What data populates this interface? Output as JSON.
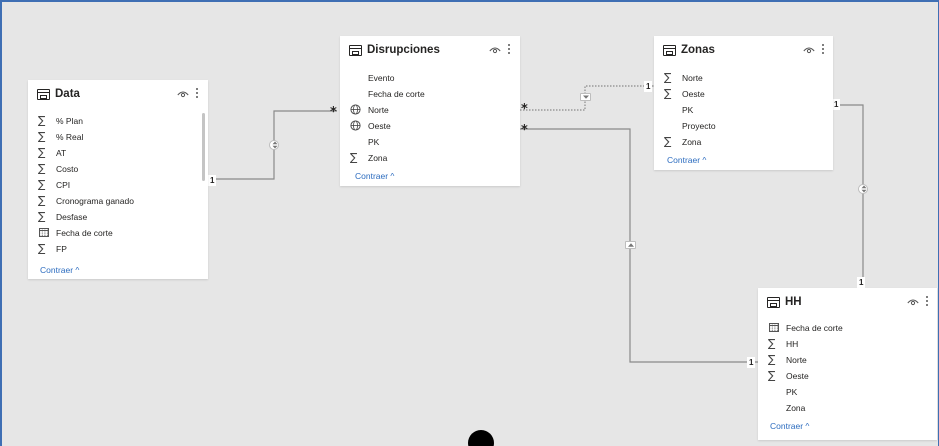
{
  "tables": {
    "data": {
      "title": "Data",
      "fields": [
        {
          "icon": "sigma-icon",
          "label": "% Plan"
        },
        {
          "icon": "sigma-icon",
          "label": "% Real"
        },
        {
          "icon": "sigma-icon",
          "label": "AT"
        },
        {
          "icon": "sigma-icon",
          "label": "Costo"
        },
        {
          "icon": "sigma-icon",
          "label": "CPI"
        },
        {
          "icon": "sigma-icon",
          "label": "Cronograma ganado"
        },
        {
          "icon": "sigma-icon",
          "label": "Desfase"
        },
        {
          "icon": "calendar-icon",
          "label": "Fecha de corte"
        },
        {
          "icon": "sigma-icon",
          "label": "FP"
        }
      ],
      "collapse": "Contraer ^"
    },
    "disrupciones": {
      "title": "Disrupciones",
      "fields": [
        {
          "icon": "none",
          "label": "Evento"
        },
        {
          "icon": "none",
          "label": "Fecha de corte"
        },
        {
          "icon": "globe-icon",
          "label": "Norte"
        },
        {
          "icon": "globe-icon",
          "label": "Oeste"
        },
        {
          "icon": "none",
          "label": "PK"
        },
        {
          "icon": "sigma-icon",
          "label": "Zona"
        }
      ],
      "collapse": "Contraer ^"
    },
    "zonas": {
      "title": "Zonas",
      "fields": [
        {
          "icon": "sigma-icon",
          "label": "Norte"
        },
        {
          "icon": "sigma-icon",
          "label": "Oeste"
        },
        {
          "icon": "none",
          "label": "PK"
        },
        {
          "icon": "none",
          "label": "Proyecto"
        },
        {
          "icon": "sigma-icon",
          "label": "Zona"
        }
      ],
      "collapse": "Contraer ^"
    },
    "hh": {
      "title": "HH",
      "fields": [
        {
          "icon": "calendar-icon",
          "label": "Fecha de corte"
        },
        {
          "icon": "sigma-icon",
          "label": "HH"
        },
        {
          "icon": "sigma-icon",
          "label": "Norte"
        },
        {
          "icon": "sigma-icon",
          "label": "Oeste"
        },
        {
          "icon": "none",
          "label": "PK"
        },
        {
          "icon": "none",
          "label": "Zona"
        }
      ],
      "collapse": "Contraer ^"
    }
  },
  "cardinality": {
    "one": "1",
    "many": "*"
  },
  "colors": {
    "canvas": "#e6e6e6",
    "accent": "#3f6fb4",
    "link": "#2c6cbf",
    "line": "#8a8a8a"
  }
}
